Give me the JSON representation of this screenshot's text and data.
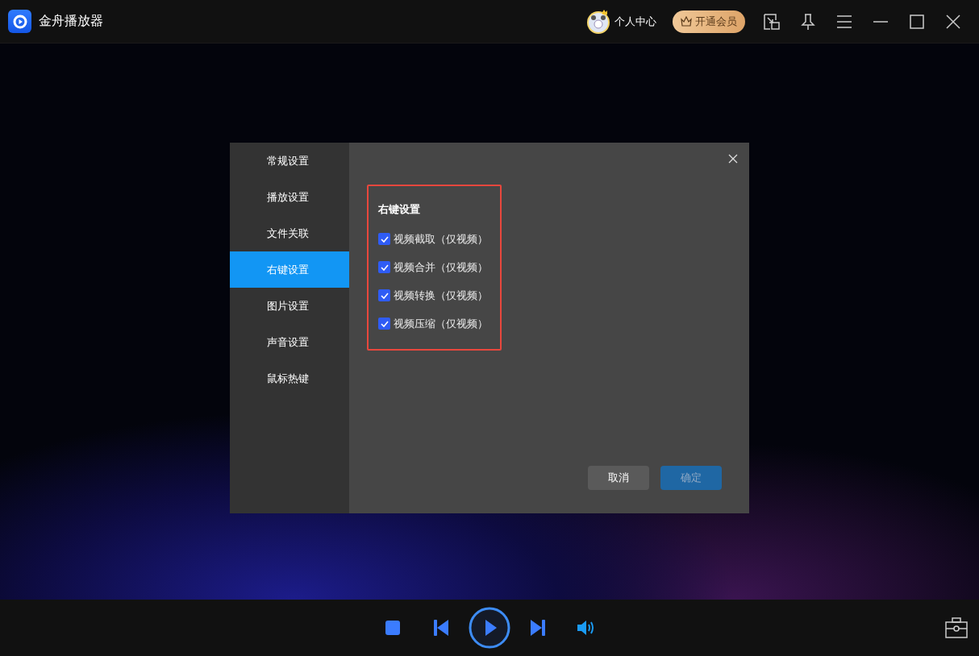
{
  "app": {
    "title": "金舟播放器",
    "user_label": "个人中心",
    "vip_label": "开通会员"
  },
  "settings_dialog": {
    "nav": [
      {
        "label": "常规设置",
        "selected": false
      },
      {
        "label": "播放设置",
        "selected": false
      },
      {
        "label": "文件关联",
        "selected": false
      },
      {
        "label": "右键设置",
        "selected": true
      },
      {
        "label": "图片设置",
        "selected": false
      },
      {
        "label": "声音设置",
        "selected": false
      },
      {
        "label": "鼠标热键",
        "selected": false
      }
    ],
    "section_title": "右键设置",
    "options": [
      {
        "label": "视频截取（仅视频）",
        "checked": true
      },
      {
        "label": "视频合并（仅视频）",
        "checked": true
      },
      {
        "label": "视频转换（仅视频）",
        "checked": true
      },
      {
        "label": "视频压缩（仅视频）",
        "checked": true
      }
    ],
    "buttons": [
      {
        "label": "取消",
        "kind": "secondary",
        "disabled": false
      },
      {
        "label": "确定",
        "kind": "primary",
        "disabled": true
      }
    ]
  }
}
